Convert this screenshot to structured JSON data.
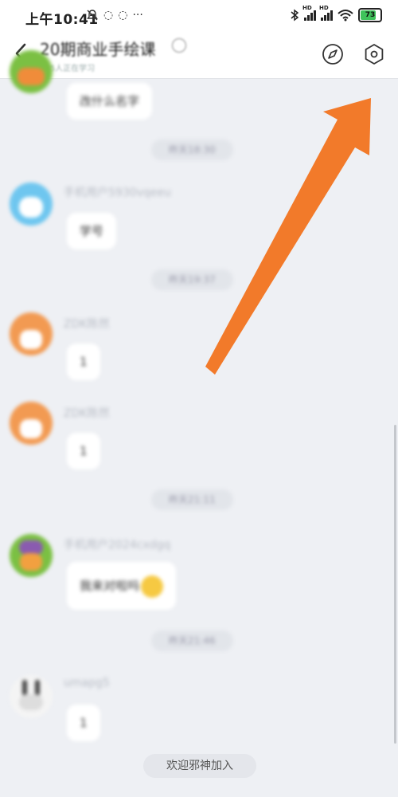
{
  "status_bar": {
    "time": "上午10:41",
    "battery": "73",
    "hd1": "HD",
    "hd2": "HD"
  },
  "header": {
    "title": "20期商业手绘课",
    "subtitle": "385人正在学习"
  },
  "messages": [
    {
      "sender": "",
      "text": "改什么名字"
    },
    {
      "time": "昨天18:30"
    },
    {
      "sender": "手机用户5930vqeeu",
      "text": "学号"
    },
    {
      "time": "昨天19:37"
    },
    {
      "sender": "ZDK陈然",
      "text": "1"
    },
    {
      "sender": "ZDK陈然",
      "text": "1"
    },
    {
      "time": "昨天21:11"
    },
    {
      "sender": "手机用户2024cxdgq",
      "text": "我来对啦吗"
    },
    {
      "time": "昨天21:46"
    },
    {
      "sender": "umapg5",
      "text": "1"
    }
  ],
  "welcome": "欢迎邪神加入",
  "colors": {
    "background": "#eef0f4",
    "arrow": "#f27a2a",
    "battery": "#3fc35b"
  },
  "icons": [
    "back-arrow-icon",
    "info-icon",
    "compass-icon",
    "settings-hexagon-icon",
    "bell-muted-icon"
  ]
}
